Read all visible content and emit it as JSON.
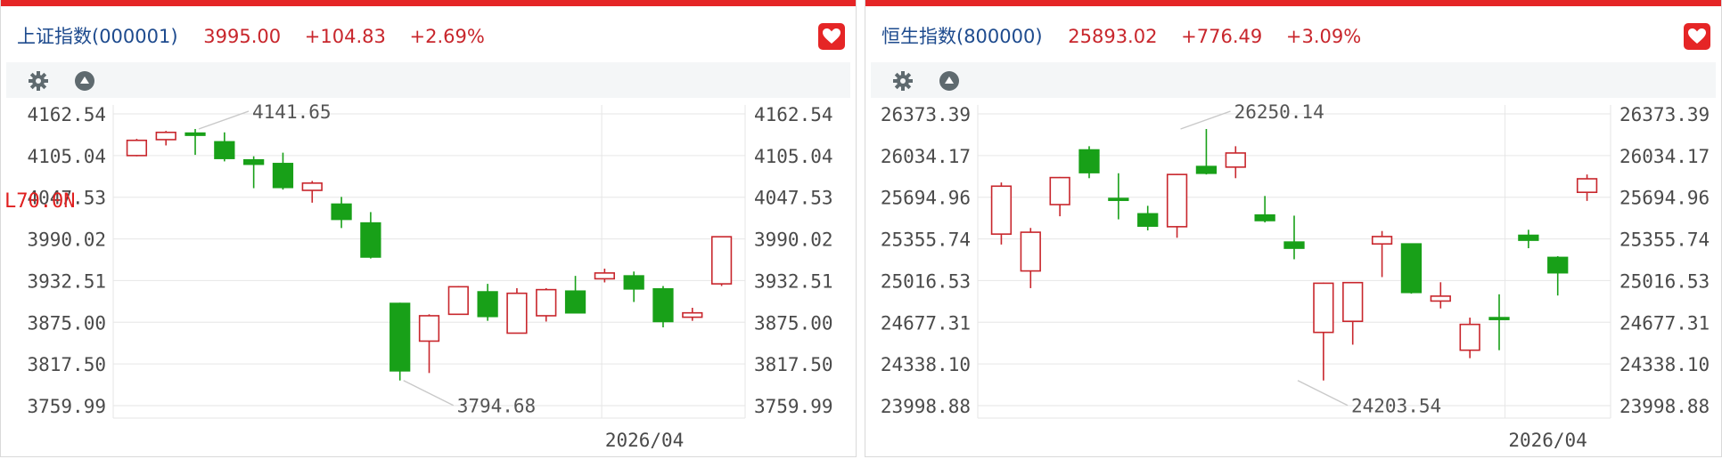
{
  "colors": {
    "up": "#c8262c",
    "down": "#18a018",
    "accent": "#e52526",
    "title": "#1e4b8e",
    "grid": "#e6e6e6",
    "axis_text": "#4a4a4a",
    "annot": "#555555"
  },
  "icons": {
    "favorite": "heart-icon",
    "settings": "gear-icon",
    "collapse": "triangle-up-icon"
  },
  "overlay_text": "L70.0N",
  "panels": [
    {
      "name": "上证指数(000001)",
      "price": "3995.00",
      "change": "+104.83",
      "change_pct": "+2.69%"
    },
    {
      "name": "恒生指数(800000)",
      "price": "25893.02",
      "change": "+776.49",
      "change_pct": "+3.09%"
    }
  ],
  "chart_data": [
    {
      "type": "candlestick",
      "ylim": [
        3759.99,
        4162.54
      ],
      "y_ticks": [
        "4162.54",
        "4105.04",
        "4047.53",
        "3990.02",
        "3932.51",
        "3875.00",
        "3817.50",
        "3759.99"
      ],
      "x_tick_label": "2026/04",
      "x_tick_index": 15.9,
      "annotations": [
        {
          "label": "4141.65",
          "index": 2,
          "value": 4141.65
        },
        {
          "label": "3794.68",
          "index": 9,
          "value": 3794.68
        }
      ],
      "candles": [
        {
          "open": 4105,
          "close": 4126,
          "high": 4128,
          "low": 4104
        },
        {
          "open": 4127,
          "close": 4137,
          "high": 4139,
          "low": 4119
        },
        {
          "open": 4136,
          "close": 4133,
          "high": 4141.65,
          "low": 4106
        },
        {
          "open": 4124,
          "close": 4101,
          "high": 4137,
          "low": 4097
        },
        {
          "open": 4099,
          "close": 4093,
          "high": 4104,
          "low": 4060
        },
        {
          "open": 4094,
          "close": 4061,
          "high": 4109,
          "low": 4058
        },
        {
          "open": 4057,
          "close": 4067,
          "high": 4070,
          "low": 4040
        },
        {
          "open": 4038,
          "close": 4017,
          "high": 4048,
          "low": 4005
        },
        {
          "open": 4012,
          "close": 3965,
          "high": 4027,
          "low": 3963
        },
        {
          "open": 3901,
          "close": 3808,
          "high": 3902,
          "low": 3794.68
        },
        {
          "open": 3849,
          "close": 3884,
          "high": 3886,
          "low": 3805
        },
        {
          "open": 3886,
          "close": 3924,
          "high": 3925,
          "low": 3886
        },
        {
          "open": 3917,
          "close": 3883,
          "high": 3928,
          "low": 3877
        },
        {
          "open": 3860,
          "close": 3915,
          "high": 3922,
          "low": 3860
        },
        {
          "open": 3884,
          "close": 3920,
          "high": 3922,
          "low": 3876
        },
        {
          "open": 3918,
          "close": 3888,
          "high": 3939,
          "low": 3888
        },
        {
          "open": 3935,
          "close": 3943,
          "high": 3949,
          "low": 3930
        },
        {
          "open": 3939,
          "close": 3921,
          "high": 3945,
          "low": 3903
        },
        {
          "open": 3921,
          "close": 3876,
          "high": 3925,
          "low": 3868
        },
        {
          "open": 3882,
          "close": 3888,
          "high": 3895,
          "low": 3877
        },
        {
          "open": 3928,
          "close": 3993,
          "high": 3993,
          "low": 3925
        }
      ]
    },
    {
      "type": "candlestick",
      "ylim": [
        23998.88,
        26373.39
      ],
      "y_ticks": [
        "26373.39",
        "26034.17",
        "25694.96",
        "25355.74",
        "25016.53",
        "24677.31",
        "24338.10",
        "23998.88"
      ],
      "x_tick_label": "2026/04",
      "x_tick_index": 17.2,
      "annotations": [
        {
          "label": "26250.14",
          "index": 6,
          "value": 26250.14
        },
        {
          "label": "24203.54",
          "index": 10,
          "value": 24203.54
        }
      ],
      "candles": [
        {
          "open": 25395,
          "close": 25785,
          "high": 25815,
          "low": 25310
        },
        {
          "open": 25095,
          "close": 25410,
          "high": 25445,
          "low": 24955
        },
        {
          "open": 25635,
          "close": 25855,
          "high": 25860,
          "low": 25540
        },
        {
          "open": 26080,
          "close": 25895,
          "high": 26110,
          "low": 25850
        },
        {
          "open": 25685,
          "close": 25670,
          "high": 25890,
          "low": 25515
        },
        {
          "open": 25560,
          "close": 25460,
          "high": 25625,
          "low": 25425
        },
        {
          "open": 25455,
          "close": 25880,
          "high": 25885,
          "low": 25365
        },
        {
          "open": 25945,
          "close": 25890,
          "high": 26250.14,
          "low": 25880
        },
        {
          "open": 25940,
          "close": 26055,
          "high": 26110,
          "low": 25850
        },
        {
          "open": 25550,
          "close": 25505,
          "high": 25705,
          "low": 25490
        },
        {
          "open": 25330,
          "close": 25280,
          "high": 25545,
          "low": 25190
        },
        {
          "open": 24595,
          "close": 24995,
          "high": 25000,
          "low": 24203.54
        },
        {
          "open": 24685,
          "close": 25000,
          "high": 25005,
          "low": 24495
        },
        {
          "open": 25315,
          "close": 25375,
          "high": 25420,
          "low": 25045
        },
        {
          "open": 25315,
          "close": 24920,
          "high": 25320,
          "low": 24910
        },
        {
          "open": 24850,
          "close": 24890,
          "high": 25003,
          "low": 24790
        },
        {
          "open": 24450,
          "close": 24660,
          "high": 24715,
          "low": 24385
        },
        {
          "open": 24715,
          "close": 24700,
          "high": 24905,
          "low": 24450
        },
        {
          "open": 25385,
          "close": 25345,
          "high": 25430,
          "low": 25280
        },
        {
          "open": 25205,
          "close": 25080,
          "high": 25215,
          "low": 24895
        },
        {
          "open": 25735,
          "close": 25845,
          "high": 25880,
          "low": 25665
        }
      ]
    }
  ]
}
